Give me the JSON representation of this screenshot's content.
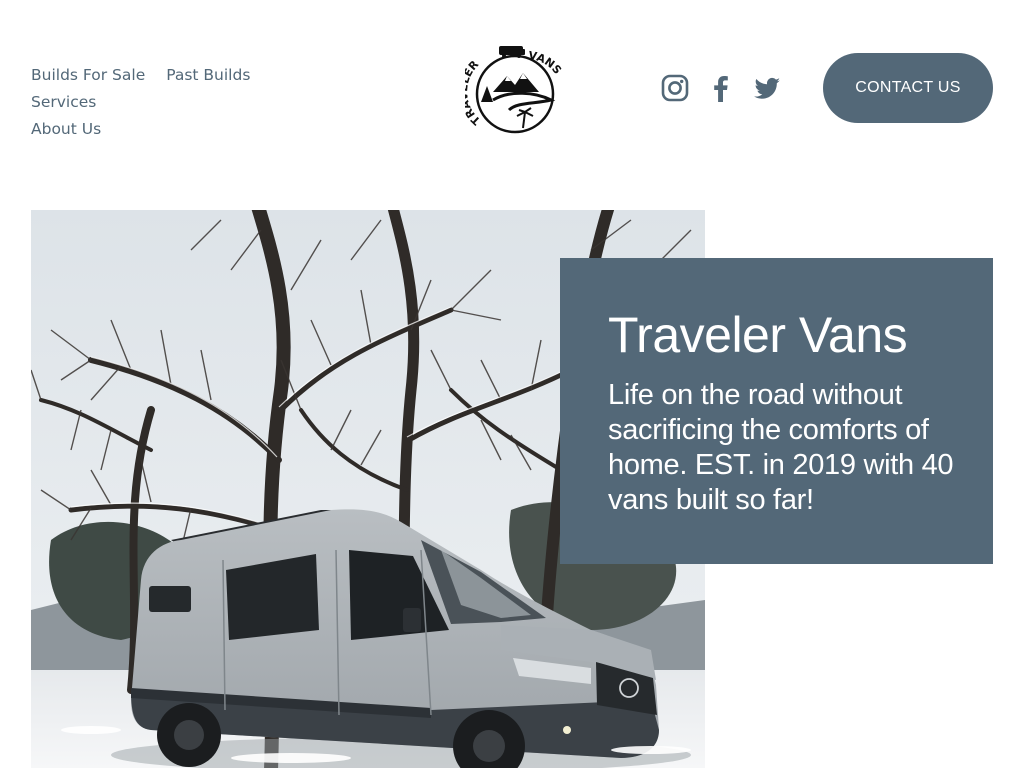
{
  "nav": {
    "items": [
      {
        "label": "Builds For Sale"
      },
      {
        "label": "Past Builds"
      },
      {
        "label": "Services"
      },
      {
        "label": "About Us"
      }
    ]
  },
  "logo": {
    "text_top": "TRAVELER",
    "text_right": "VANS"
  },
  "social": {
    "icons": [
      "instagram-icon",
      "facebook-icon",
      "twitter-icon"
    ]
  },
  "contact_button": {
    "label": "CONTACT US"
  },
  "hero": {
    "title": "Traveler Vans",
    "text": "Life on the road without sacrificing the comforts of home. EST. in 2019 with 40 vans built so far!",
    "image_description_icon": "van-in-snow-photo"
  },
  "colors": {
    "accent": "#536878",
    "text_on_accent": "#ffffff",
    "background": "#ffffff"
  }
}
